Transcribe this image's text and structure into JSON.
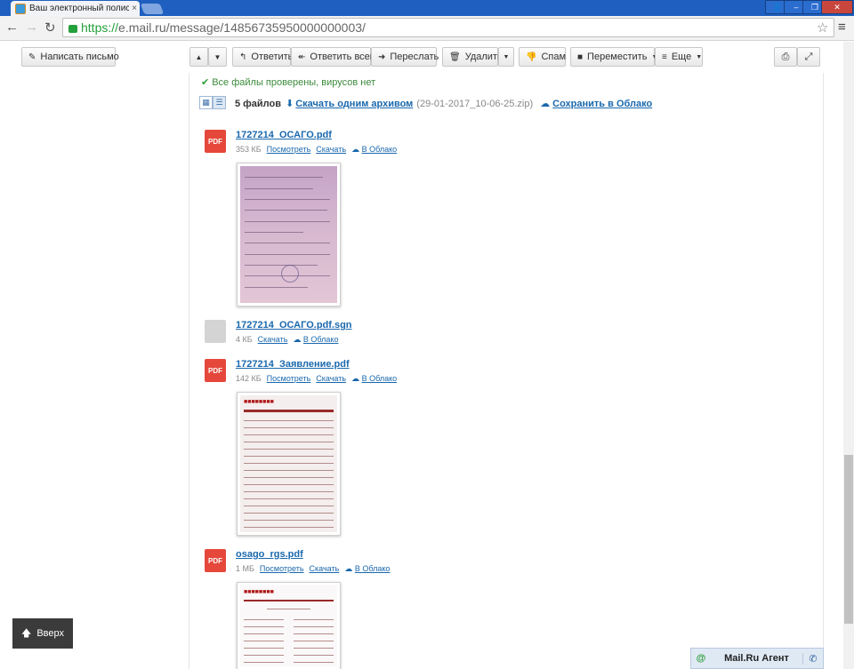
{
  "browser": {
    "tab_title": "Ваш электронный полис ОС",
    "tab_close": "×",
    "url_https": "https://",
    "url_rest": "e.mail.ru/message/14856735950000000003/"
  },
  "toolbar": {
    "compose": "Написать письмо",
    "reply": "Ответить",
    "reply_all": "Ответить всем",
    "forward": "Переслать",
    "delete": "Удалить",
    "spam": "Спам",
    "move": "Переместить",
    "more": "Еще"
  },
  "attachments": {
    "virus_status": "Все файлы проверены, вирусов нет",
    "count_label": "5 файлов",
    "download_all": "Скачать одним архивом",
    "archive_name": "(29-01-2017_10-06-25.zip)",
    "save_cloud": "Сохранить в Облако",
    "files": [
      {
        "name": "1727214_ОСАГО.pdf",
        "size": "353 КБ",
        "view": "Посмотреть",
        "download": "Скачать",
        "cloud": "В Облако",
        "icon": "PDF"
      },
      {
        "name": "1727214_ОСАГО.pdf.sgn",
        "size": "4 КБ",
        "download": "Скачать",
        "cloud": "В Облако"
      },
      {
        "name": "1727214_Заявление.pdf",
        "size": "142 КБ",
        "view": "Посмотреть",
        "download": "Скачать",
        "cloud": "В Облако",
        "icon": "PDF"
      },
      {
        "name": "osago_rgs.pdf",
        "size": "1 МБ",
        "view": "Посмотреть",
        "download": "Скачать",
        "cloud": "В Облако",
        "icon": "PDF"
      }
    ]
  },
  "footer": {
    "scroll_up": "Вверх",
    "agent": "Mail.Ru Агент"
  },
  "colors": {
    "link": "#1a68ad",
    "pdf": "#e5483b",
    "ok": "#3c8a3c"
  }
}
